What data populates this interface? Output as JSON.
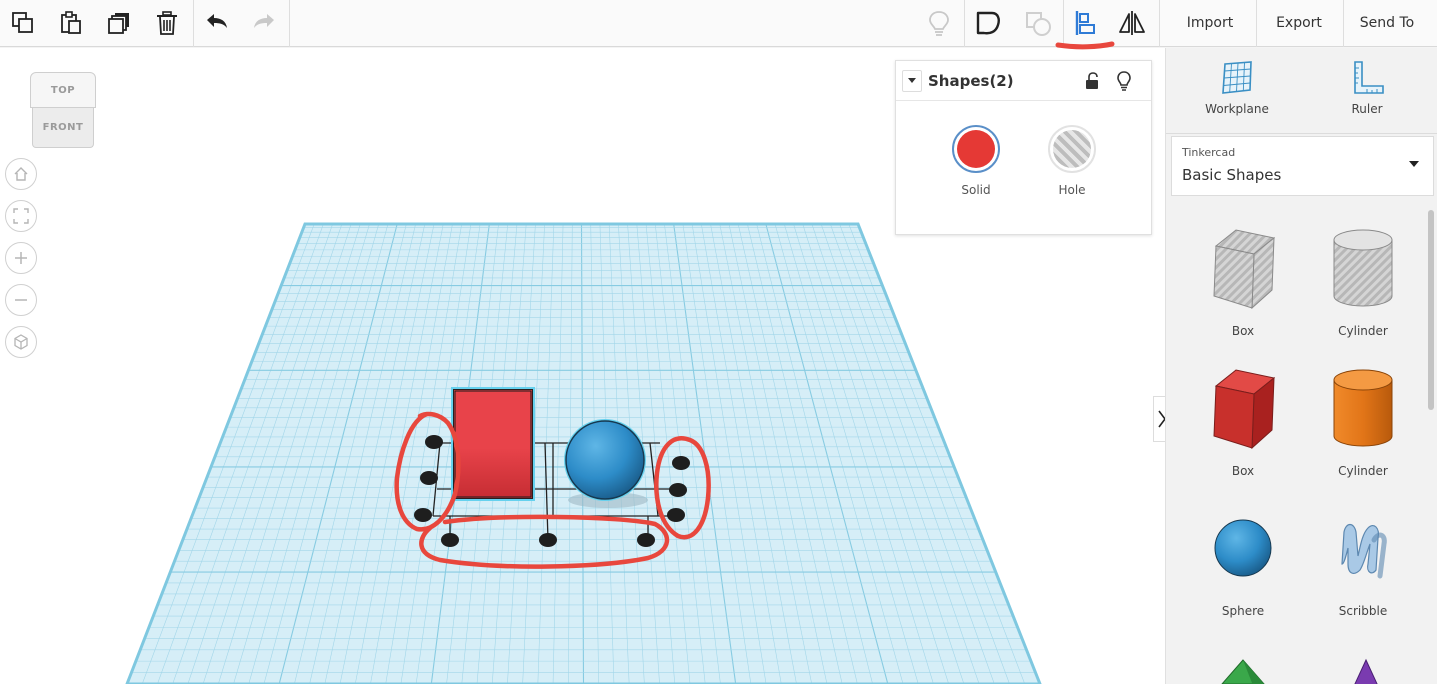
{
  "toolbar": {
    "tools_left": [
      "copy-icon",
      "paste-icon",
      "duplicate-icon",
      "delete-icon",
      "undo-icon",
      "redo-icon"
    ],
    "tools_right": [
      "light-bulb-icon",
      "group-icon",
      "ungroup-icon",
      "align-icon",
      "mirror-icon"
    ],
    "import_label": "Import",
    "export_label": "Export",
    "send_to_label": "Send To"
  },
  "view_cube": {
    "top_label": "TOP",
    "front_label": "FRONT"
  },
  "nav_controls": [
    "home-icon",
    "fit-view-icon",
    "zoom-in-icon",
    "zoom-out-icon",
    "ortho-view-icon"
  ],
  "shape_panel": {
    "title": "Shapes(2)",
    "solid_label": "Solid",
    "hole_label": "Hole",
    "solid_color": "#e53935"
  },
  "right_panel": {
    "workplane_label": "Workplane",
    "ruler_label": "Ruler",
    "library": {
      "provider": "Tinkercad",
      "selected": "Basic Shapes"
    },
    "shapes": [
      {
        "label": "Box",
        "kind": "box-hole"
      },
      {
        "label": "Cylinder",
        "kind": "cylinder-hole"
      },
      {
        "label": "Box",
        "kind": "box-red"
      },
      {
        "label": "Cylinder",
        "kind": "cylinder-orange"
      },
      {
        "label": "Sphere",
        "kind": "sphere-blue"
      },
      {
        "label": "Scribble",
        "kind": "scribble"
      }
    ]
  },
  "colors": {
    "workplane": "#cdeaf4",
    "grid_line": "#7fc8e0",
    "box": "#e53935",
    "sphere": "#2d8cc8",
    "annotation": "#e8473d",
    "align_active": "#2f7bd6"
  }
}
